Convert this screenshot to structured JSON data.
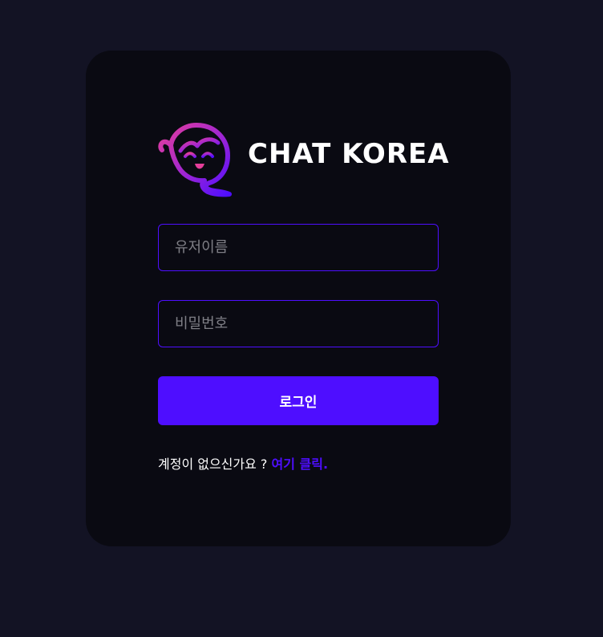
{
  "brand": {
    "logo_icon": "chat-girl-logo-icon",
    "title": "CHAT KOREA"
  },
  "form": {
    "username_placeholder": "유저이름",
    "password_placeholder": "비밀번호",
    "submit_label": "로그인"
  },
  "footer": {
    "question": "계정이 없으신가요 ?",
    "link_label": "여기 클릭."
  },
  "colors": {
    "background": "#131324",
    "card": "#0a0a12",
    "accent": "#4e0eff",
    "logo_gradient_start": "#e53e9a",
    "logo_gradient_end": "#4e0eff"
  }
}
